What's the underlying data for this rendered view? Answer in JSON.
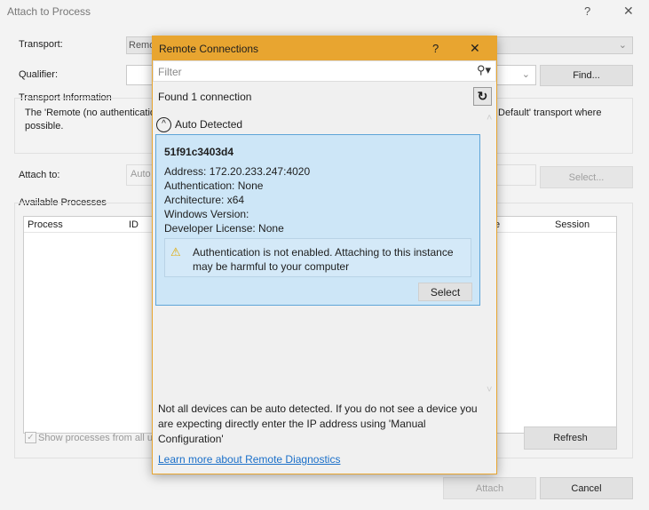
{
  "window": {
    "title": "Attach to Process",
    "help": "?",
    "close": "✕"
  },
  "transport": {
    "label": "Transport:",
    "value": "Remo"
  },
  "qualifier": {
    "label": "Qualifier:",
    "value": "",
    "find": "Find..."
  },
  "transport_info": {
    "label": "Transport Information",
    "text_left": "The 'Remote (no authenticatio",
    "text_right": "Default' transport where",
    "text_line2": "possible."
  },
  "attach_to": {
    "label": "Attach to:",
    "value": "Auto",
    "select": "Select..."
  },
  "processes": {
    "label": "Available Processes",
    "columns": [
      "Process",
      "ID",
      "e",
      "Session"
    ],
    "show_all_label": "Show processes from all use",
    "show_all_checked": true,
    "refresh": "Refresh"
  },
  "footer": {
    "attach": "Attach",
    "cancel": "Cancel"
  },
  "dialog": {
    "title": "Remote Connections",
    "help": "?",
    "close": "✕",
    "accent": "#e8a530",
    "filter_placeholder": "Filter",
    "found": "Found 1 connection",
    "group": "Auto Detected",
    "device": {
      "name": "51f91c3403d4",
      "address": "Address:  172.20.233.247:4020",
      "authentication": "Authentication:  None",
      "architecture": "Architecture:  x64",
      "windows_version": "Windows Version:",
      "developer_license": "Developer License:  None",
      "warning": "Authentication is not enabled. Attaching to this instance may be harmful to your computer",
      "select": "Select"
    },
    "note": "Not all devices can be auto detected. If you do not see a device you are expecting directly enter the IP address using 'Manual Configuration'",
    "link": "Learn more about Remote Diagnostics"
  }
}
